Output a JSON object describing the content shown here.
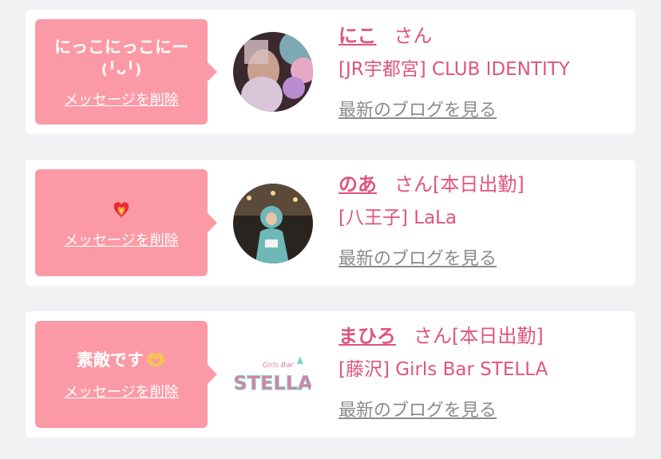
{
  "messages": [
    {
      "message_text": "にっこにっこにー\n(╹ᴗ╹)",
      "delete_label": "メッセージを削除",
      "name": "にこ",
      "honorific": "さん",
      "attendance": "",
      "shop": "[JR宇都宮] CLUB IDENTITY",
      "blog_label": "最新のブログを見る",
      "avatar_icon": "profile-photo"
    },
    {
      "message_text": "",
      "message_emoji": "heart-on-fire-icon",
      "delete_label": "メッセージを削除",
      "name": "のあ",
      "honorific": "さん",
      "attendance": "[本日出勤]",
      "shop": "[八王子] LaLa",
      "blog_label": "最新のブログを見る",
      "avatar_icon": "profile-photo"
    },
    {
      "message_text": "素敵です",
      "message_emoji": "heart-hands-icon",
      "delete_label": "メッセージを削除",
      "name": "まひろ",
      "honorific": "さん",
      "attendance": "[本日出勤]",
      "shop": "[藤沢] Girls Bar STELLA",
      "blog_label": "最新のブログを見る",
      "avatar_icon": "shop-logo",
      "logo_small_text": "Girls Bar",
      "logo_text": "STELLA"
    }
  ],
  "colors": {
    "bubble": "#fb9aa6",
    "accent": "#e0557a",
    "link_gray": "#8b8b8b",
    "background": "#f2f2f4"
  }
}
